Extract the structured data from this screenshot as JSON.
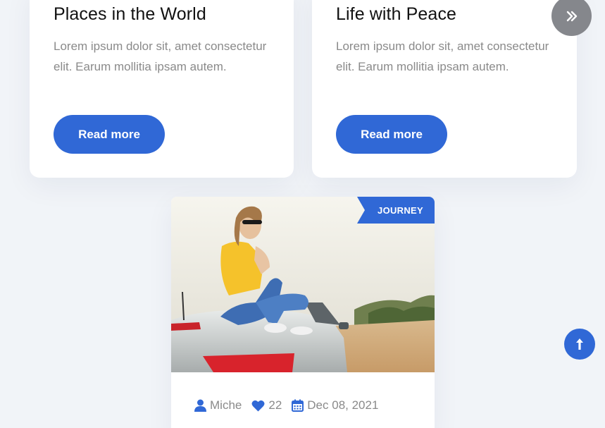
{
  "cards": [
    {
      "title": "Places in the World",
      "text": "Lorem ipsum dolor sit, amet consectetur elit. Earum mollitia ipsam autem.",
      "button_label": "Read more"
    },
    {
      "title": "Life with Peace",
      "text": "Lorem ipsum dolor sit, amet consectetur elit. Earum mollitia ipsam autem.",
      "button_label": "Read more"
    }
  ],
  "featured_post": {
    "tag": "JOURNEY",
    "author": "Miche",
    "likes": "22",
    "date": "Dec 08, 2021"
  },
  "icons": {
    "next": "double-chevron-right-icon",
    "back_to_top": "arrow-up-icon",
    "author": "user-icon",
    "likes": "heart-icon",
    "date": "calendar-icon"
  },
  "colors": {
    "accent": "#3068d6",
    "background": "#f1f4f8",
    "muted_text": "#8a8a8a",
    "nav_button": "#85878c"
  }
}
